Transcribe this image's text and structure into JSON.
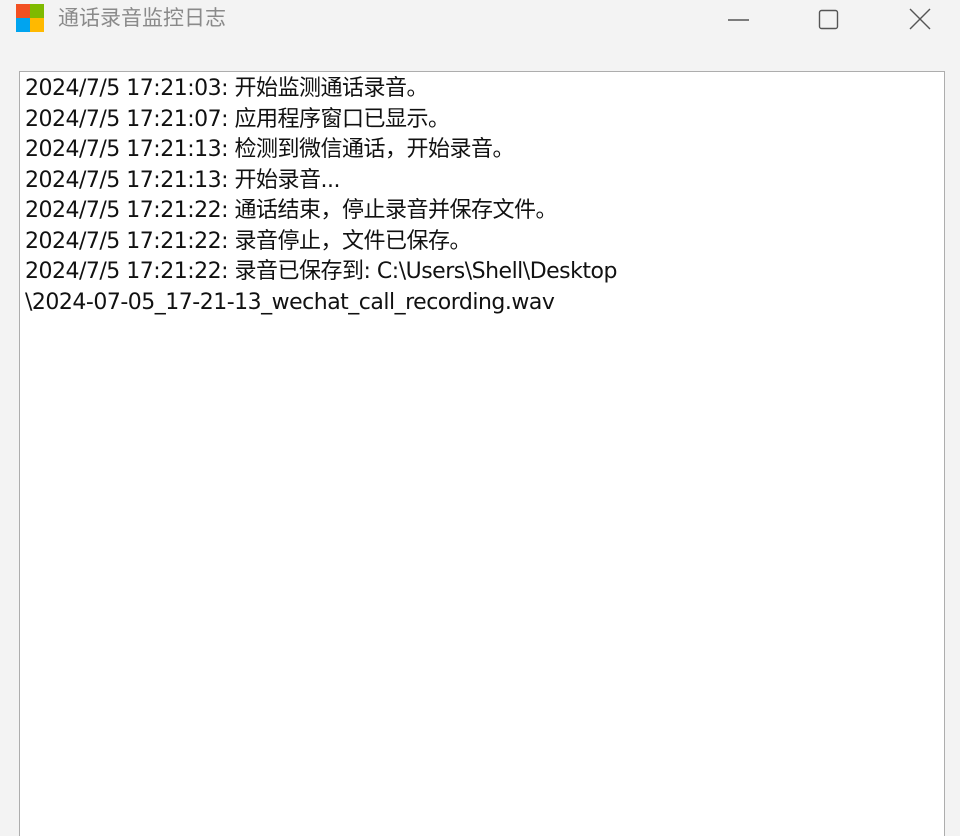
{
  "window": {
    "title": "通话录音监控日志",
    "icon": "app-icon-four-squares",
    "controls": {
      "minimize": "minimize-icon",
      "maximize": "maximize-icon",
      "close": "close-icon"
    }
  },
  "log": {
    "lines": [
      "2024/7/5 17:21:03: 开始监测通话录音。",
      "2024/7/5 17:21:07: 应用程序窗口已显示。",
      "2024/7/5 17:21:13: 检测到微信通话，开始录音。",
      "2024/7/5 17:21:13: 开始录音...",
      "2024/7/5 17:21:22: 通话结束，停止录音并保存文件。",
      "2024/7/5 17:21:22: 录音停止，文件已保存。",
      "2024/7/5 17:21:22: 录音已保存到: C:\\Users\\Shell\\Desktop",
      "\\2024-07-05_17-21-13_wechat_call_recording.wav"
    ]
  },
  "colors": {
    "titlebar_bg": "#f3f3f3",
    "title_text": "#8a8a8a",
    "log_bg": "#ffffff",
    "log_border": "#adadad",
    "log_text": "#111111"
  }
}
